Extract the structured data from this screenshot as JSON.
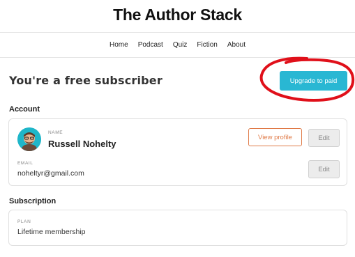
{
  "site": {
    "title": "The Author Stack"
  },
  "nav": {
    "items": [
      "Home",
      "Podcast",
      "Quiz",
      "Fiction",
      "About"
    ]
  },
  "status": {
    "heading": "You're a free subscriber",
    "upgrade_label": "Upgrade to paid"
  },
  "account": {
    "section_title": "Account",
    "name_label": "NAME",
    "name_value": "Russell Nohelty",
    "email_label": "EMAIL",
    "email_value": "noheltyr@gmail.com",
    "view_profile_label": "View profile",
    "edit_label": "Edit"
  },
  "subscription": {
    "section_title": "Subscription",
    "plan_label": "PLAN",
    "plan_value": "Lifetime membership"
  },
  "colors": {
    "accent": "#29b7d3",
    "view_profile_border": "#e07a47",
    "annotation": "#e0101a"
  }
}
